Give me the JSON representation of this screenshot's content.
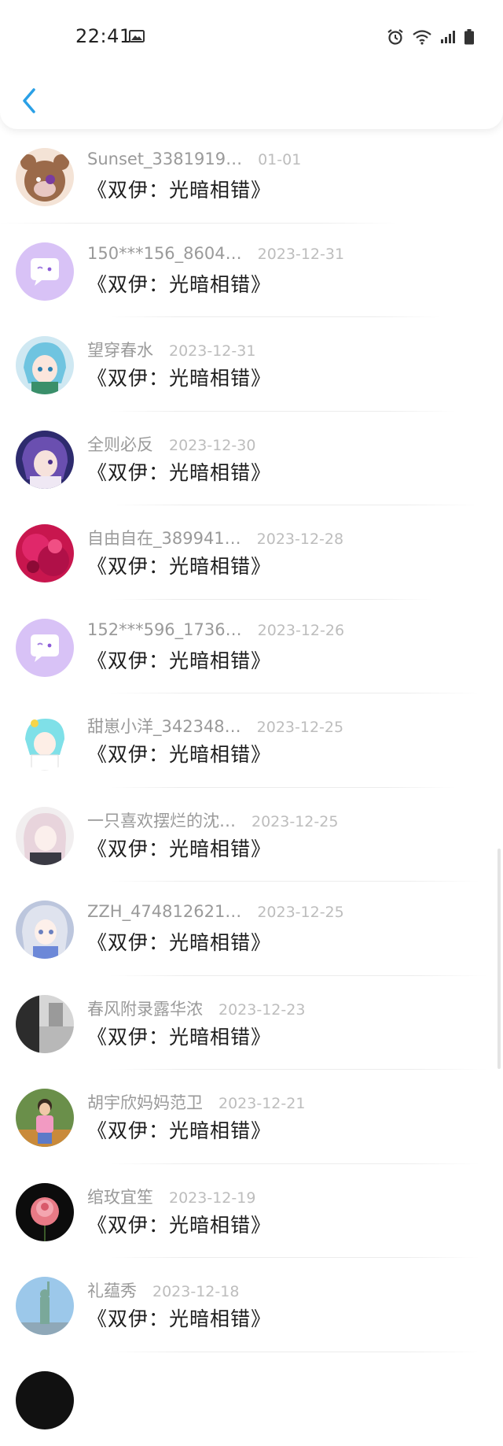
{
  "status_bar": {
    "time": "22:41",
    "icons": [
      "image-icon",
      "alarm-icon",
      "wifi-icon",
      "signal-icon",
      "battery-icon"
    ]
  },
  "header": {
    "back_icon": "chevron-left-icon",
    "accent": "#2aa0e6"
  },
  "items": [
    {
      "name": "Sunset_3381919…",
      "date": "01-01",
      "title": "《双伊：光暗相错》",
      "avatar": "bear-brown"
    },
    {
      "name": "150***156_8604…",
      "date": "2023-12-31",
      "title": "《双伊：光暗相错》",
      "avatar": "chat-purple"
    },
    {
      "name": "望穿春水",
      "date": "2023-12-31",
      "title": "《双伊：光暗相错》",
      "avatar": "anime-blue"
    },
    {
      "name": "全则必反",
      "date": "2023-12-30",
      "title": "《双伊：光暗相错》",
      "avatar": "anime-purple"
    },
    {
      "name": "自由自在_389941…",
      "date": "2023-12-28",
      "title": "《双伊：光暗相错》",
      "avatar": "red-flower"
    },
    {
      "name": "152***596_1736…",
      "date": "2023-12-26",
      "title": "《双伊：光暗相错》",
      "avatar": "chat-purple"
    },
    {
      "name": "甜崽小洋_342348…",
      "date": "2023-12-25",
      "title": "《双伊：光暗相错》",
      "avatar": "anime-cyan"
    },
    {
      "name": "一只喜欢摆烂的沈…",
      "date": "2023-12-25",
      "title": "《双伊：光暗相错》",
      "avatar": "anime-pink"
    },
    {
      "name": "ZZH_474812621…",
      "date": "2023-12-25",
      "title": "《双伊：光暗相错》",
      "avatar": "anime-silver"
    },
    {
      "name": "春风附录露华浓",
      "date": "2023-12-23",
      "title": "《双伊：光暗相错》",
      "avatar": "photo-gray"
    },
    {
      "name": "胡宇欣妈妈范卫",
      "date": "2023-12-21",
      "title": "《双伊：光暗相错》",
      "avatar": "photo-child"
    },
    {
      "name": "绾玫宜笙",
      "date": "2023-12-19",
      "title": "《双伊：光暗相错》",
      "avatar": "rose-dark"
    },
    {
      "name": "礼蕴秀",
      "date": "2023-12-18",
      "title": "《双伊：光暗相错》",
      "avatar": "statue-blue"
    },
    {
      "name": "",
      "date": "",
      "title": "",
      "avatar": "dark-partial"
    }
  ]
}
